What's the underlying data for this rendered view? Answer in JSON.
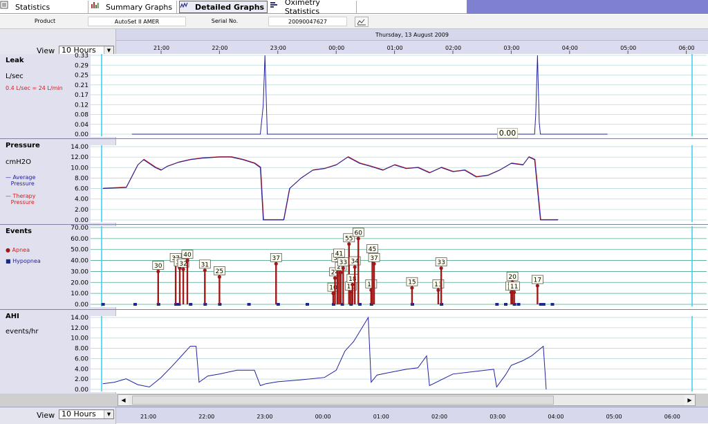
{
  "tabs": [
    {
      "label": "Statistics",
      "icon": "statistics-icon"
    },
    {
      "label": "Summary Graphs",
      "icon": "bar-chart-icon"
    },
    {
      "label": "Detailed Graphs",
      "icon": "line-chart-icon"
    },
    {
      "label": "Oximetry Statistics",
      "icon": "oximetry-icon"
    }
  ],
  "info": {
    "product_label": "Product",
    "product_value": "AutoSet II AMER",
    "serial_label": "Serial No.",
    "serial_value": "20090047627"
  },
  "header": {
    "date": "Thursday, 13 August 2009",
    "view_label": "View",
    "view_value": "10 Hours",
    "time_ticks": [
      "21:00",
      "22:00",
      "23:00",
      "00:00",
      "01:00",
      "02:00",
      "03:00",
      "04:00",
      "05:00",
      "06:00"
    ]
  },
  "panels": {
    "leak": {
      "title": "Leak",
      "unit": "L/sec",
      "note": "0.4 L/sec = 24 L/min",
      "cursor_value": "0.00"
    },
    "pressure": {
      "title": "Pressure",
      "unit": "cmH2O",
      "legend_avg_1": "Average",
      "legend_avg_2": "Pressure",
      "legend_ther_1": "Therapy",
      "legend_ther_2": "Pressure"
    },
    "events": {
      "title": "Events",
      "legend_apnea": "Apnea",
      "legend_hypopnea": "Hypopnea"
    },
    "ahi": {
      "title": "AHI",
      "unit": "events/hr"
    }
  },
  "bottom": {
    "view_label": "View",
    "view_value": "10 Hours",
    "time_ticks": [
      "21:00",
      "22:00",
      "23:00",
      "00:00",
      "01:00",
      "02:00",
      "03:00",
      "04:00",
      "05:00",
      "06:00"
    ]
  },
  "colors": {
    "avg": "#2020a0",
    "therapy": "#d02020",
    "apnea": "#a01818",
    "hypopnea": "#1a2a8a",
    "cursor": "#40d0f0"
  },
  "chart_data": [
    {
      "type": "line",
      "title": "Leak",
      "ylabel": "L/sec",
      "yticks": [
        "0.33",
        "0.29",
        "0.25",
        "0.21",
        "0.17",
        "0.12",
        "0.08",
        "0.04",
        "0.00"
      ],
      "ylim": [
        0,
        0.33
      ],
      "x": [
        20.5,
        22.7,
        22.75,
        22.78,
        22.82,
        23.0,
        27.0,
        27.05,
        27.08,
        27.15,
        27.4,
        27.42,
        27.45,
        27.48,
        27.5,
        28.65
      ],
      "values": [
        0,
        0,
        0.12,
        0.33,
        0,
        0,
        0,
        0.02,
        0,
        0,
        0,
        0.08,
        0.33,
        0.05,
        0,
        0
      ]
    },
    {
      "type": "line",
      "title": "Pressure",
      "ylabel": "cmH2O",
      "yticks": [
        "14.00",
        "12.00",
        "10.00",
        "8.00",
        "6.00",
        "4.00",
        "2.00",
        "0.00"
      ],
      "ylim": [
        0,
        14
      ],
      "series": [
        {
          "name": "Average Pressure",
          "x": [
            20.0,
            20.4,
            20.6,
            20.7,
            20.9,
            21.0,
            21.1,
            21.3,
            21.5,
            21.7,
            22.0,
            22.2,
            22.4,
            22.6,
            22.7,
            22.75,
            23.1,
            23.2,
            23.4,
            23.6,
            23.8,
            24.0,
            24.2,
            24.4,
            24.6,
            24.8,
            25.0,
            25.2,
            25.4,
            25.6,
            25.8,
            26.0,
            26.2,
            26.4,
            26.6,
            26.8,
            27.0,
            27.2,
            27.3,
            27.4,
            27.5,
            27.8
          ],
          "values": [
            6,
            6.2,
            10.5,
            11.5,
            10,
            9.5,
            10.2,
            11,
            11.5,
            11.8,
            12,
            12,
            11.5,
            10.8,
            10,
            0,
            0,
            6,
            8,
            9.5,
            9.8,
            10.5,
            12,
            10.8,
            10.2,
            9.5,
            10.5,
            9.8,
            10,
            9,
            10,
            9.2,
            9.5,
            8.2,
            8.5,
            9.5,
            10.8,
            10.5,
            12,
            11.5,
            0,
            0
          ]
        },
        {
          "name": "Therapy Pressure",
          "x": [
            20.0,
            20.4,
            20.6,
            20.7,
            20.9,
            21.0,
            21.1,
            21.3,
            21.5,
            21.7,
            22.0,
            22.2,
            22.4,
            22.6,
            22.7,
            22.75,
            23.1,
            23.2,
            23.4,
            23.6,
            23.8,
            24.0,
            24.2,
            24.4,
            24.6,
            24.8,
            25.0,
            25.2,
            25.4,
            25.6,
            25.8,
            26.0,
            26.2,
            26.4,
            26.6,
            26.8,
            27.0,
            27.2,
            27.3,
            27.4,
            27.5,
            27.8
          ],
          "values": [
            6,
            6.2,
            10.5,
            11.5,
            10,
            9.5,
            10.2,
            11,
            11.5,
            11.8,
            12,
            12,
            11.5,
            10.8,
            10,
            0,
            0,
            6,
            8,
            9.5,
            9.8,
            10.5,
            12,
            10.8,
            10.2,
            9.5,
            10.5,
            9.8,
            10,
            9,
            10,
            9.2,
            9.5,
            8.2,
            8.5,
            9.5,
            10.8,
            10.5,
            12,
            11.5,
            0,
            0
          ]
        }
      ]
    },
    {
      "type": "bar",
      "title": "Events",
      "yticks": [
        "70.00",
        "60.00",
        "50.00",
        "40.00",
        "30.00",
        "20.00",
        "10.00",
        "0.00"
      ],
      "ylim": [
        0,
        70
      ],
      "series": [
        {
          "name": "Apnea",
          "x": [
            20.95,
            21.25,
            21.32,
            21.38,
            21.45,
            21.75,
            22.0,
            22.97,
            23.95,
            23.98,
            24.02,
            24.05,
            24.08,
            24.12,
            24.22,
            24.25,
            24.28,
            24.32,
            24.38,
            24.6,
            24.62,
            24.65,
            25.3,
            25.75,
            25.8,
            27.0,
            27.02,
            27.05,
            27.45
          ],
          "values": [
            30,
            37,
            33,
            32,
            40,
            31,
            25,
            37,
            10,
            24,
            37,
            41,
            29,
            33,
            55,
            11,
            18,
            34,
            60,
            13,
            45,
            37,
            15,
            13,
            33,
            11,
            20,
            11,
            17
          ]
        },
        {
          "name": "Hypopnea",
          "x": [
            20.0,
            20.55,
            20.95,
            21.25,
            21.3,
            21.5,
            21.75,
            22.0,
            22.5,
            23.0,
            23.5,
            23.95,
            24.1,
            24.25,
            24.4,
            24.6,
            25.3,
            25.8,
            26.75,
            26.9,
            27.05,
            27.12,
            27.5,
            27.55,
            27.7
          ],
          "values": [
            0,
            0,
            0,
            0,
            0,
            0,
            0,
            0,
            0,
            0,
            0,
            0,
            0,
            0,
            0,
            0,
            0,
            0,
            0,
            0,
            0,
            0,
            0,
            0,
            0
          ]
        }
      ],
      "labels": [
        "30",
        "37",
        "3",
        "32",
        "40",
        "31",
        "25",
        "1",
        "37",
        "10",
        "2",
        "3",
        "41",
        "29",
        "55",
        "1",
        "18",
        "2",
        "34",
        "47",
        "60",
        "1",
        "45",
        "37",
        "15",
        "13",
        "33",
        "20",
        "11",
        "1",
        "17"
      ]
    },
    {
      "type": "line",
      "title": "AHI",
      "ylabel": "events/hr",
      "yticks": [
        "14.00",
        "12.00",
        "10.00",
        "8.00",
        "6.00",
        "4.00",
        "2.00",
        "0.00"
      ],
      "ylim": [
        0,
        15
      ],
      "x": [
        20.0,
        20.2,
        20.4,
        20.6,
        20.8,
        21.0,
        21.2,
        21.35,
        21.5,
        21.6,
        21.65,
        21.8,
        22.0,
        22.3,
        22.6,
        22.7,
        22.8,
        23.0,
        23.4,
        23.8,
        24.0,
        24.15,
        24.3,
        24.45,
        24.55,
        24.6,
        24.7,
        24.9,
        25.2,
        25.4,
        25.55,
        25.6,
        25.8,
        26.0,
        26.4,
        26.7,
        26.75,
        26.9,
        27.0,
        27.2,
        27.35,
        27.45,
        27.55,
        27.6
      ],
      "values": [
        1.2,
        1.5,
        2.2,
        1.0,
        0.5,
        2.5,
        5,
        7,
        9,
        9,
        1.5,
        2.8,
        3.2,
        4,
        4,
        0.8,
        1.2,
        1.6,
        2,
        2.5,
        4,
        8,
        10,
        13,
        15,
        1.5,
        3,
        3.5,
        4.2,
        4.5,
        7,
        0.8,
        2,
        3.2,
        3.8,
        4.2,
        0.5,
        3,
        5,
        6,
        7,
        8,
        9,
        0
      ]
    }
  ]
}
